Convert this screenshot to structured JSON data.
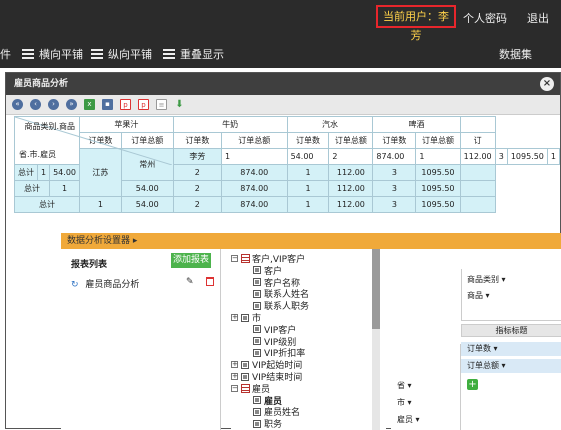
{
  "topbar": {
    "current_user": "当前用户：李芳",
    "profile_link": "个人密码",
    "logout_link": "退出",
    "toolbar": {
      "partial_item": "件",
      "horizontal_tile": "横向平铺",
      "vertical_tile": "纵向平铺",
      "overlap_display": "重叠显示",
      "dataset": "数据集"
    }
  },
  "dialog": {
    "title": "雇员商品分析",
    "close": "×",
    "tools": [
      "first-icon",
      "prev-icon",
      "next-icon",
      "last-icon",
      "excel-icon",
      "save-icon",
      "pdf-icon",
      "pdf-icon",
      "doc-icon",
      "download-icon"
    ]
  },
  "pivot": {
    "corner_top": "商品类别.商品",
    "corner_bottom": "省.市.雇员",
    "products": [
      "苹果汁",
      "牛奶",
      "汽水",
      "啤酒"
    ],
    "measures": [
      "订单数",
      "订单总额"
    ],
    "row_province": "江苏",
    "row_city": "常州",
    "row_employee": "李芳",
    "subtotal": "总计",
    "grand_total": "总计",
    "detail_row": [
      "1",
      "54.00",
      "2",
      "874.00",
      "1",
      "112.00",
      "3",
      "1095.50",
      "1"
    ],
    "total_row": [
      "1",
      "54.00",
      "2",
      "874.00",
      "1",
      "112.00",
      "3",
      "1095.50"
    ],
    "partial_measure": "订",
    "partial_header": "订"
  },
  "settings": {
    "bar_title": "数据分析设置器 ▸",
    "report_list_title": "报表列表",
    "add_report": "添加报表",
    "report_name": "雇员商品分析",
    "tree": [
      {
        "type": "dim",
        "label": "客户,VIP客户",
        "toggle": "−",
        "indent": 0
      },
      {
        "type": "field",
        "label": "客户",
        "indent": 1
      },
      {
        "type": "field",
        "label": "客户名称",
        "indent": 1
      },
      {
        "type": "field",
        "label": "联系人姓名",
        "indent": 1
      },
      {
        "type": "field",
        "label": "联系人职务",
        "indent": 1
      },
      {
        "type": "field",
        "label": "市",
        "toggle": "+",
        "indent": 0
      },
      {
        "type": "field",
        "label": "VIP客户",
        "indent": 1
      },
      {
        "type": "field",
        "label": "VIP级别",
        "indent": 1
      },
      {
        "type": "field",
        "label": "VIP折扣率",
        "indent": 1
      },
      {
        "type": "field",
        "label": "VIP起始时间",
        "toggle": "+",
        "indent": 0
      },
      {
        "type": "field",
        "label": "VIP结束时间",
        "toggle": "+",
        "indent": 0
      },
      {
        "type": "dim",
        "label": "雇员",
        "toggle": "−",
        "indent": 0
      },
      {
        "type": "field",
        "label": "雇员",
        "indent": 1,
        "bold": true
      },
      {
        "type": "field",
        "label": "雇员姓名",
        "indent": 1
      },
      {
        "type": "field",
        "label": "职务",
        "indent": 1
      }
    ],
    "layout": {
      "col_fields": [
        "商品类别 ▾",
        "商品 ▾"
      ],
      "measure_title": "指标标题",
      "measures": [
        "订单数 ▾",
        "订单总额 ▾"
      ],
      "row_fields": [
        "省 ▾",
        "市 ▾",
        "雇员 ▾"
      ],
      "plus": "+"
    }
  }
}
